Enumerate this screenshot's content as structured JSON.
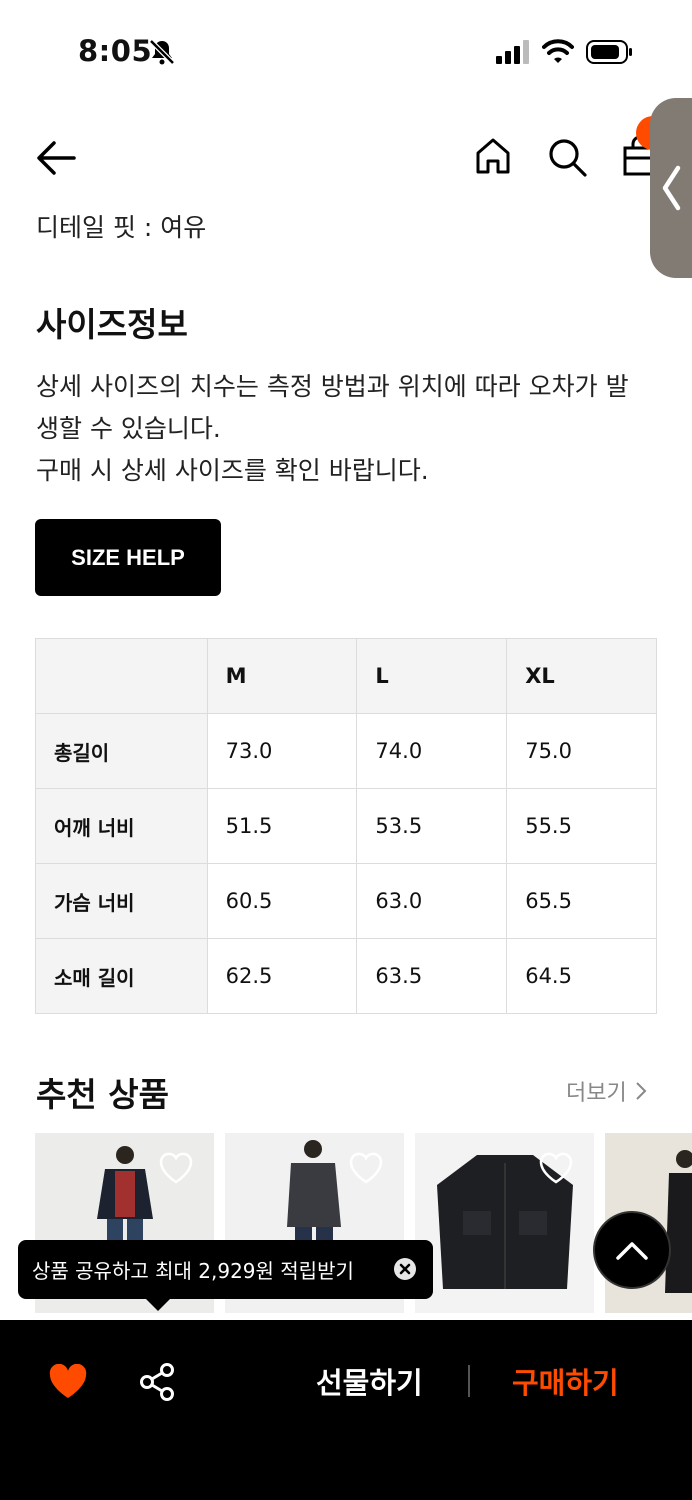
{
  "status_bar": {
    "time": "8:05"
  },
  "product": {
    "detail_fit": "디테일 핏 : 여유"
  },
  "size_info": {
    "title": "사이즈정보",
    "note_lines": [
      "상세 사이즈의 치수는 측정 방법과 위치에 따라 오차가 발",
      "생할 수 있습니다.",
      "구매 시 상세 사이즈를 확인 바랍니다."
    ],
    "help_button": "SIZE HELP",
    "table": {
      "columns": [
        "",
        "M",
        "L",
        "XL"
      ],
      "rows": [
        {
          "label": "총길이",
          "values": [
            "73.0",
            "74.0",
            "75.0"
          ]
        },
        {
          "label": "어깨 너비",
          "values": [
            "51.5",
            "53.5",
            "55.5"
          ]
        },
        {
          "label": "가슴 너비",
          "values": [
            "60.5",
            "63.0",
            "65.5"
          ]
        },
        {
          "label": "소매 길이",
          "values": [
            "62.5",
            "63.5",
            "64.5"
          ]
        }
      ]
    }
  },
  "recommended": {
    "title": "추천 상품",
    "more_label": "더보기"
  },
  "tooltip": {
    "text": "상품 공유하고 최대 2,929원 적립받기"
  },
  "bottom_bar": {
    "gift_label": "선물하기",
    "buy_label": "구매하기"
  },
  "colors": {
    "accent": "#ff4b00",
    "background": "#ffffff",
    "bar": "#000000"
  }
}
